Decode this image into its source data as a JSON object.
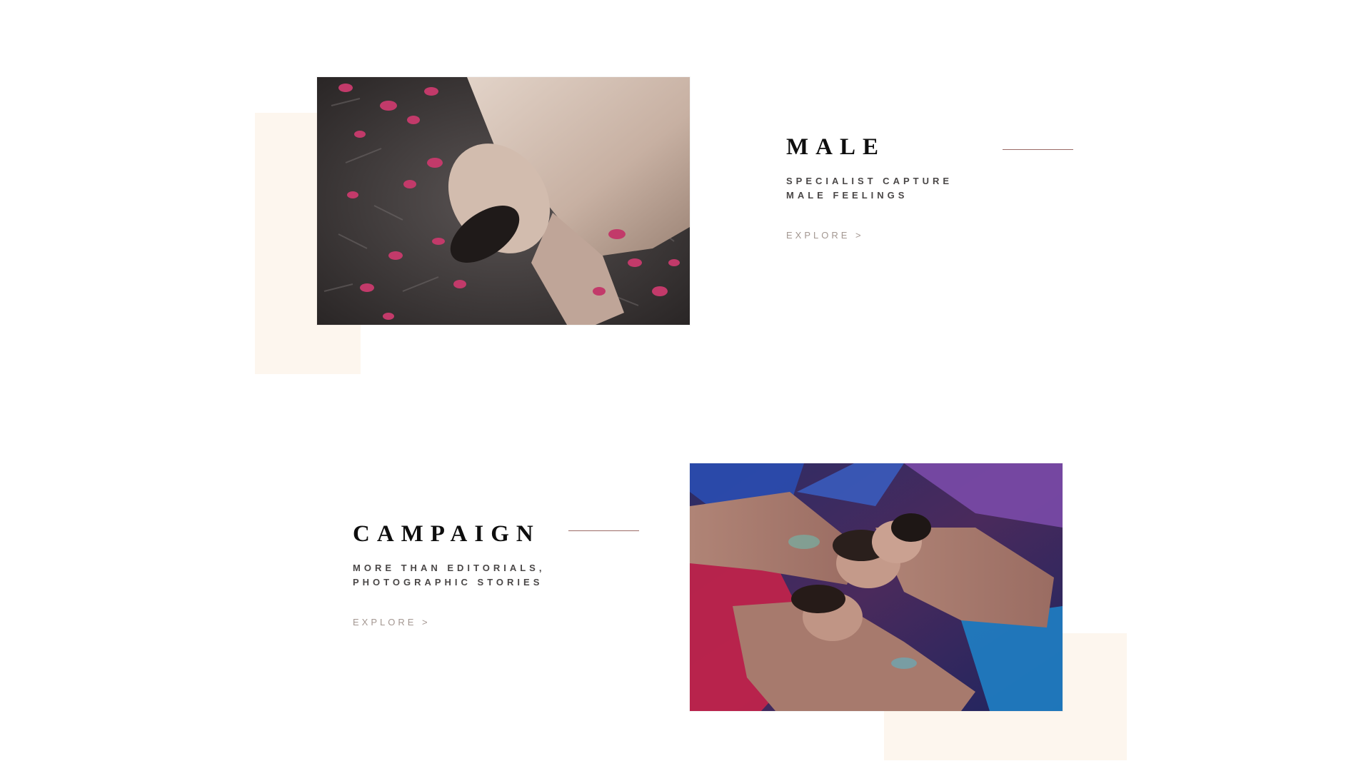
{
  "colors": {
    "cream_block": "#fdf6ee",
    "rule": "#9b6b66",
    "title": "#0e0e0e",
    "subtitle": "#4a4747",
    "explore": "#a39791"
  },
  "sections": [
    {
      "title": "MALE",
      "subtitle_line1": "SPECIALIST CAPTURE",
      "subtitle_line2": "MALE FEELINGS",
      "explore_label": "EXPLORE >",
      "image_alt": "man lying on grass with pink petals"
    },
    {
      "title": "CAMPAIGN",
      "subtitle_line1": "MORE THAN EDITORIALS,",
      "subtitle_line2": "PHOTOGRAPHIC STORIES",
      "explore_label": "EXPLORE >",
      "image_alt": "group of men lying on colorful fabrics"
    }
  ]
}
